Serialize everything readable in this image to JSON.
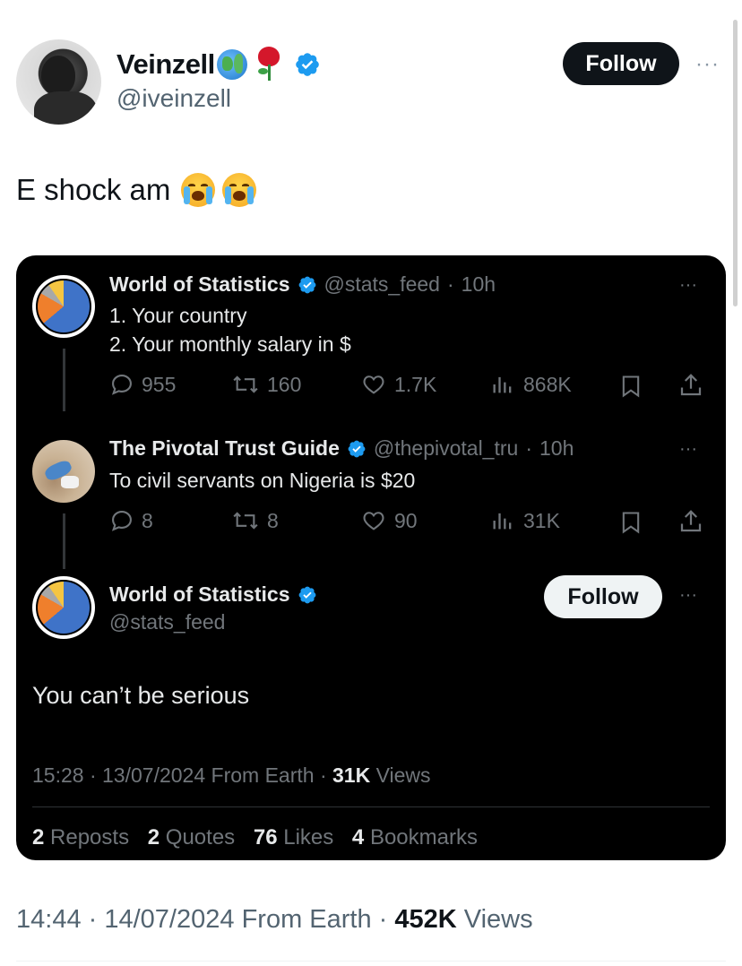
{
  "outer_tweet": {
    "author_name": "Veinzell",
    "handle": "@iveinzell",
    "follow_label": "Follow",
    "more_label": "···",
    "text": "E shock am",
    "emojis": [
      "globe-icon",
      "rose-icon",
      "loudly-crying-face",
      "loudly-crying-face"
    ],
    "footer": {
      "time": "14:44",
      "date": "14/07/2024",
      "source": "From Earth",
      "views_count": "452K",
      "views_label": "Views"
    }
  },
  "quoted": {
    "thread": [
      {
        "author_name": "World of Statistics",
        "handle": "@stats_feed",
        "age": "10h",
        "lines": [
          "1. Your country",
          "2. Your monthly salary in $"
        ],
        "replies": "955",
        "reposts": "160",
        "likes": "1.7K",
        "views": "868K"
      },
      {
        "author_name": "The Pivotal Trust Guide",
        "handle": "@thepivotal_tru",
        "age": "10h",
        "lines": [
          "To civil servants on Nigeria is $20"
        ],
        "replies": "8",
        "reposts": "8",
        "likes": "90",
        "views": "31K"
      }
    ],
    "main": {
      "author_name": "World of Statistics",
      "handle": "@stats_feed",
      "follow_label": "Follow",
      "text": "You can’t be serious",
      "time": "15:28",
      "date": "13/07/2024",
      "source": "From Earth",
      "views_count": "31K",
      "views_label": "Views",
      "stats": {
        "reposts_count": "2",
        "reposts_label": "Reposts",
        "quotes_count": "2",
        "quotes_label": "Quotes",
        "likes_count": "76",
        "likes_label": "Likes",
        "bookmarks_count": "4",
        "bookmarks_label": "Bookmarks"
      }
    }
  },
  "colors": {
    "verified_blue": "#1d9bf0",
    "card_bg": "#000000",
    "muted": "#71767b"
  }
}
